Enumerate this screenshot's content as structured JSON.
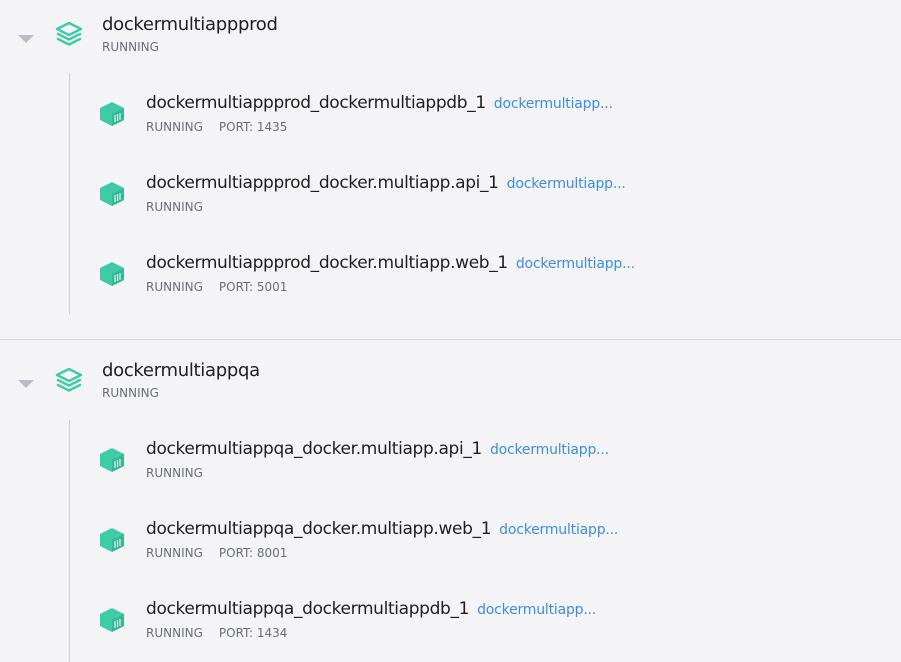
{
  "colors": {
    "accent_teal": "#3fcba8",
    "link_blue": "#3c8de0",
    "background": "#f4f4f7"
  },
  "groups": [
    {
      "name": "dockermultiappprod",
      "status": "RUNNING",
      "icon": "stack-layers-icon",
      "containers": [
        {
          "name": "dockermultiappprod_dockermultiappdb_1",
          "image_link": "dockermultiapp...",
          "status": "RUNNING",
          "port": "PORT: 1435",
          "icon": "container-cube-icon"
        },
        {
          "name": "dockermultiappprod_docker.multiapp.api_1",
          "image_link": "dockermultiapp...",
          "status": "RUNNING",
          "port": "",
          "icon": "container-cube-icon"
        },
        {
          "name": "dockermultiappprod_docker.multiapp.web_1",
          "image_link": "dockermultiapp...",
          "status": "RUNNING",
          "port": "PORT: 5001",
          "icon": "container-cube-icon"
        }
      ]
    },
    {
      "name": "dockermultiappqa",
      "status": "RUNNING",
      "icon": "stack-layers-icon",
      "containers": [
        {
          "name": "dockermultiappqa_docker.multiapp.api_1",
          "image_link": "dockermultiapp...",
          "status": "RUNNING",
          "port": "",
          "icon": "container-cube-icon"
        },
        {
          "name": "dockermultiappqa_docker.multiapp.web_1",
          "image_link": "dockermultiapp...",
          "status": "RUNNING",
          "port": "PORT: 8001",
          "icon": "container-cube-icon"
        },
        {
          "name": "dockermultiappqa_dockermultiappdb_1",
          "image_link": "dockermultiapp...",
          "status": "RUNNING",
          "port": "PORT: 1434",
          "icon": "container-cube-icon"
        }
      ]
    }
  ]
}
